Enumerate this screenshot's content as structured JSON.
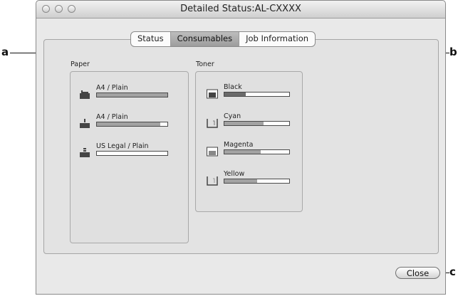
{
  "window": {
    "title": "Detailed Status:AL-CXXXX"
  },
  "tabs": [
    {
      "label": "Status"
    },
    {
      "label": "Consumables"
    },
    {
      "label": "Job Information"
    }
  ],
  "active_tab": "Consumables",
  "callouts": {
    "a": "a",
    "b": "b",
    "c": "c"
  },
  "paper": {
    "group_label": "Paper",
    "trays": [
      {
        "label": "A4 / Plain",
        "icon": "mp-tray-icon",
        "level": 1.0
      },
      {
        "label": "A4 / Plain",
        "icon": "tray-1-icon",
        "level": 0.9
      },
      {
        "label": "US Legal / Plain",
        "icon": "tray-2-icon",
        "level": 0.0
      }
    ]
  },
  "toner": {
    "group_label": "Toner",
    "cartridges": [
      {
        "label": "Black",
        "icon": "toner-black-icon",
        "level": 0.33
      },
      {
        "label": "Cyan",
        "icon": "toner-cyan-icon",
        "level": 0.6
      },
      {
        "label": "Magenta",
        "icon": "toner-magenta-icon",
        "level": 0.56
      },
      {
        "label": "Yellow",
        "icon": "toner-yellow-icon",
        "level": 0.5
      }
    ]
  },
  "close_button": {
    "label": "Close"
  }
}
